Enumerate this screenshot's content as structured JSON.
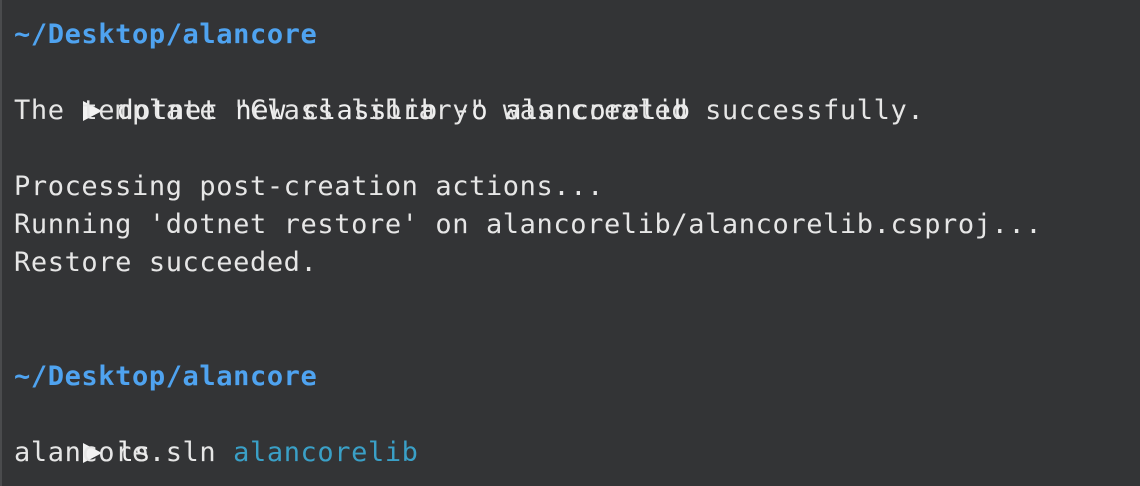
{
  "session1": {
    "path": "~/Desktop/alancore",
    "command": "dotnet new classlib -o alancorelib",
    "output": [
      "The template \"Class library\" was created successfully.",
      "",
      "Processing post-creation actions...",
      "Running 'dotnet restore' on alancorelib/alancorelib.csproj...",
      "Restore succeeded."
    ]
  },
  "session2": {
    "path": "~/Desktop/alancore",
    "command": "ls",
    "listing": {
      "file": "alancore.sln",
      "directory": "alancorelib"
    }
  },
  "colors": {
    "background": "#333436",
    "path": "#4fa3f0",
    "directory": "#3aa0c7",
    "text": "#e6e6e6"
  }
}
